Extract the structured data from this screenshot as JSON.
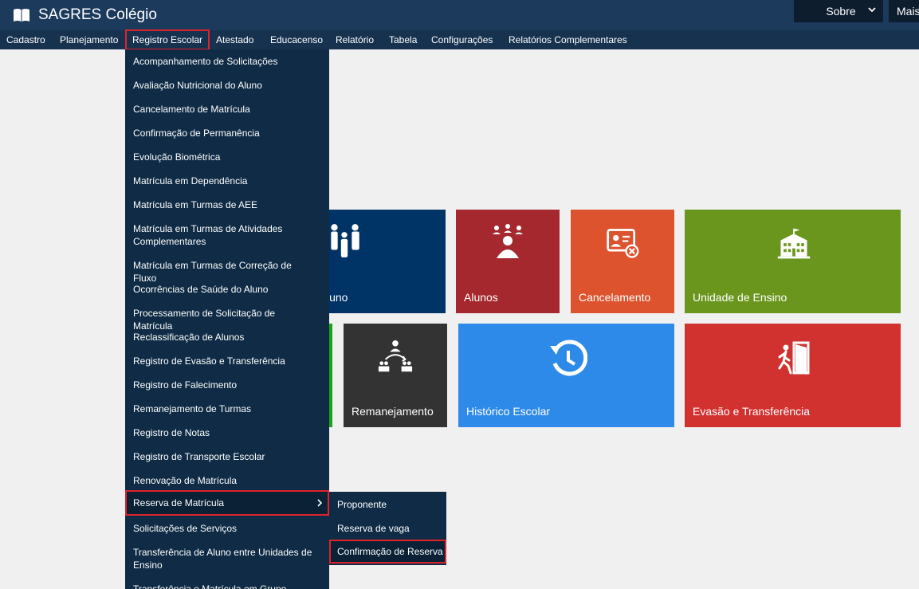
{
  "header": {
    "app_title": "SAGRES Colégio",
    "sobre_label": "Sobre",
    "mais_label": "Mais"
  },
  "nav": [
    "Cadastro",
    "Planejamento",
    "Registro Escolar",
    "Atestado",
    "Educacenso",
    "Relatório",
    "Tabela",
    "Configurações",
    "Relatórios Complementares"
  ],
  "dropdown": [
    "Acompanhamento de Solicitações",
    "Avaliação Nutricional do Aluno",
    "Cancelamento de Matrícula",
    "Confirmação de Permanência",
    "Evolução Biométrica",
    "Matrícula em Dependência",
    "Matrícula em Turmas de AEE",
    "Matrícula em Turmas de Atividades Complementares",
    "Matrícula em Turmas de Correção de Fluxo",
    "Ocorrências de Saúde do Aluno",
    "Processamento de Solicitação de Matrícula",
    "Reclassificação de Alunos",
    "Registro de Evasão e Transferência",
    "Registro de Falecimento",
    "Remanejamento de Turmas",
    "Registro de Notas",
    "Registro de Transporte Escolar",
    "Renovação de Matrícula",
    "Reserva de Matrícula",
    "Solicitações de Serviços",
    "Transferência de Aluno entre Unidades de Ensino",
    "Transferência e Matrícula em Grupo"
  ],
  "submenu": [
    "Proponente",
    "Reserva de vaga",
    "Confirmação de Reserva"
  ],
  "tiles": [
    {
      "label": "luno",
      "color": "#003366",
      "icon": "family-icon"
    },
    {
      "label": "Alunos",
      "color": "#a4282e",
      "icon": "students-group-icon"
    },
    {
      "label": "Cancelamento",
      "color": "#dc532e",
      "icon": "id-card-cancel-icon"
    },
    {
      "label": "Unidade de Ensino",
      "color": "#6b961d",
      "icon": "school-building-icon"
    },
    {
      "label": "",
      "color": "#19a519",
      "icon": ""
    },
    {
      "label": "Remanejamento",
      "color": "#333333",
      "icon": "reassign-students-icon"
    },
    {
      "label": "Histórico Escolar",
      "color": "#2d8ae8",
      "icon": "history-clock-icon"
    },
    {
      "label": "Evasão e Transferência",
      "color": "#d13230",
      "icon": "exit-door-icon"
    }
  ]
}
